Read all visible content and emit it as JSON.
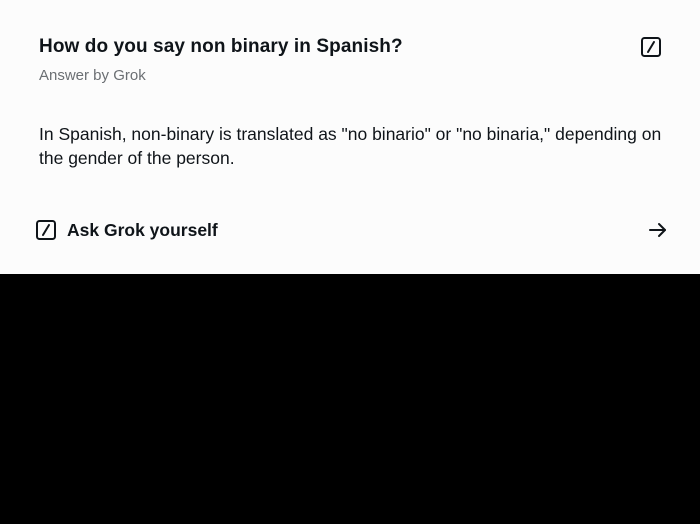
{
  "card": {
    "title": "How do you say non binary in Spanish?",
    "subtitle": "Answer by Grok",
    "answer": "In Spanish, non-binary is translated as \"no binario\" or \"no binaria,\" depending on the gender of the person.",
    "ask_label": "Ask Grok yourself",
    "icons": {
      "header": "grok-icon",
      "ask": "grok-icon",
      "arrow": "arrow-right-icon"
    }
  },
  "colors": {
    "card_background": "#fcfcfc",
    "page_background": "#000000",
    "text_primary": "#0f1419",
    "text_secondary": "#6b6f73"
  }
}
